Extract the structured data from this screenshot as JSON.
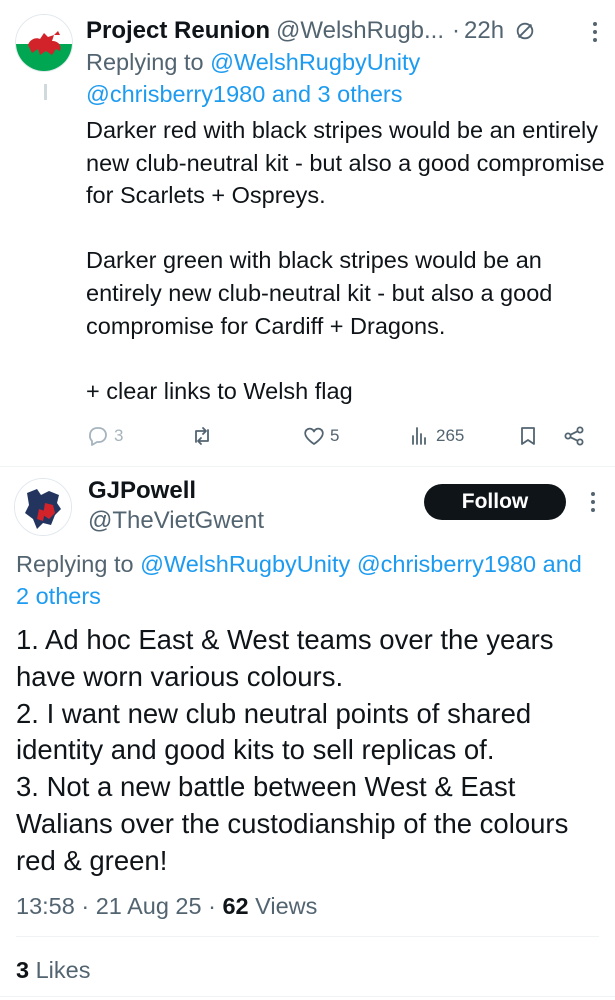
{
  "reply_tweet": {
    "display_name": "Project Reunion",
    "handle": "@WelshRugb...",
    "separator": "·",
    "time_ago": "22h",
    "replying_prefix": "Replying to",
    "replying_mention1": "@WelshRugbyUnity",
    "replying_mention2": "@chrisberry1980 and 3 others",
    "body": [
      "Darker red with black stripes would be an entirely new club-neutral kit - but also a good compromise for Scarlets + Ospreys.",
      "Darker green with black stripes would be an entirely new club-neutral kit - but also a good compromise for Cardiff + Dragons.",
      "+ clear links to Welsh flag"
    ],
    "reply_count": "3",
    "like_count": "5",
    "view_count": "265",
    "avatar_icon": "welsh-dragon-flag-avatar"
  },
  "main_tweet": {
    "display_name": "GJPowell",
    "handle": "@TheVietGwent",
    "follow_label": "Follow",
    "replying_prefix": "Replying to",
    "replying_mentions": "@WelshRugbyUnity @chrisberry1980 and",
    "replying_others": "2 others",
    "body": [
      "1. Ad hoc East & West teams over the years have worn various colours.",
      "2. I want new club neutral points of shared identity and good kits to sell replicas of.",
      "3. Not a new battle between West & East Walians over the custodianship of the colours red & green!"
    ],
    "time": "13:58",
    "date": "21 Aug 25",
    "views_count": "62",
    "views_label": "Views",
    "likes_count": "3",
    "likes_label": "Likes",
    "meta_separator": "·"
  },
  "colors": {
    "text": "#0f1419",
    "muted": "#536471",
    "link": "#1d9bf0",
    "follow_bg": "#0f1419",
    "divider": "#eff3f4"
  }
}
